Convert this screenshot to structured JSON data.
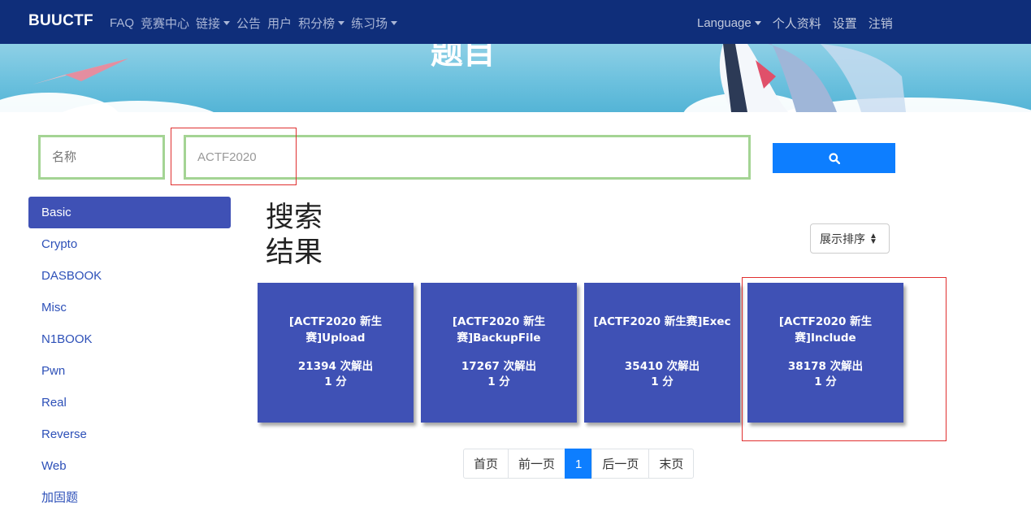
{
  "navbar": {
    "brand": "BUUCTF",
    "left_items": [
      {
        "label": "FAQ",
        "dropdown": false
      },
      {
        "label": "竞赛中心",
        "dropdown": false
      },
      {
        "label": "链接",
        "dropdown": true
      },
      {
        "label": "公告",
        "dropdown": false
      },
      {
        "label": "用户",
        "dropdown": false
      },
      {
        "label": "积分榜",
        "dropdown": true
      },
      {
        "label": "练习场",
        "dropdown": true
      }
    ],
    "right_items": [
      {
        "label": "Language",
        "dropdown": true
      },
      {
        "label": "个人资料",
        "dropdown": false
      },
      {
        "label": "设置",
        "dropdown": false
      },
      {
        "label": "注销",
        "dropdown": false
      }
    ]
  },
  "banner": {
    "title": "题目"
  },
  "search": {
    "field_placeholder": "名称",
    "query_value": "ACTF2020",
    "button_icon": "search-icon"
  },
  "sidebar": {
    "items": [
      {
        "label": "Basic",
        "active": true
      },
      {
        "label": "Crypto",
        "active": false
      },
      {
        "label": "DASBOOK",
        "active": false
      },
      {
        "label": "Misc",
        "active": false
      },
      {
        "label": "N1BOOK",
        "active": false
      },
      {
        "label": "Pwn",
        "active": false
      },
      {
        "label": "Real",
        "active": false
      },
      {
        "label": "Reverse",
        "active": false
      },
      {
        "label": "Web",
        "active": false
      },
      {
        "label": "加固题",
        "active": false
      }
    ]
  },
  "results": {
    "title": "搜索结果",
    "sort_label": "展示排序",
    "cards": [
      {
        "name": "[ACTF2020 新生赛]Upload",
        "solves": "21394 次解出",
        "points": "1 分"
      },
      {
        "name": "[ACTF2020 新生赛]BackupFile",
        "solves": "17267 次解出",
        "points": "1 分"
      },
      {
        "name": "[ACTF2020 新生赛]Exec",
        "solves": "35410 次解出",
        "points": "1 分"
      },
      {
        "name": "[ACTF2020 新生赛]Include",
        "solves": "38178 次解出",
        "points": "1 分"
      }
    ]
  },
  "pagination": {
    "first": "首页",
    "prev": "前一页",
    "current": "1",
    "next": "后一页",
    "last": "末页"
  },
  "colors": {
    "navbar": "#0f2e7a",
    "accent": "#3f51b5",
    "primary_button": "#0d7eff",
    "highlight_box": "#e03030",
    "input_border": "#a4d494"
  }
}
